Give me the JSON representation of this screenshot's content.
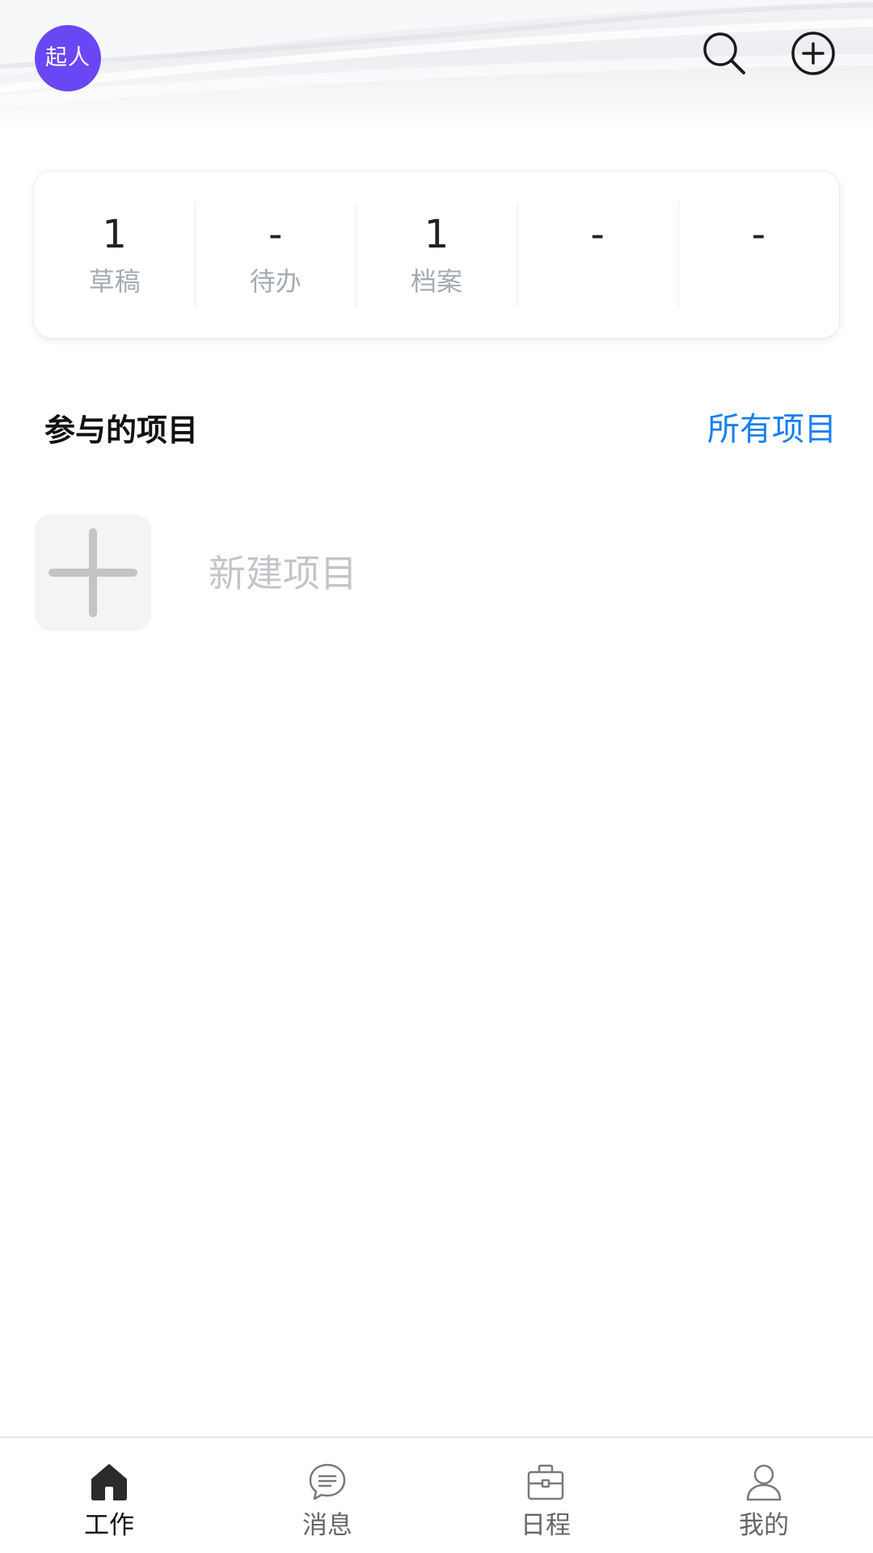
{
  "header": {
    "avatar_text": "起人",
    "avatar_color": "#6a47f5",
    "icons": [
      "search-icon",
      "add-circle-icon"
    ]
  },
  "stats": [
    {
      "value": "1",
      "label": "草稿"
    },
    {
      "value": "-",
      "label": "待办"
    },
    {
      "value": "1",
      "label": "档案"
    },
    {
      "value": "-",
      "label": ""
    },
    {
      "value": "-",
      "label": ""
    }
  ],
  "projects": {
    "title": "参与的项目",
    "all_link": "所有项目",
    "new_label": "新建项目",
    "link_color": "#1a7ff0"
  },
  "tabbar": {
    "active": "work",
    "tabs": [
      {
        "id": "work",
        "label": "工作",
        "icon": "home-icon"
      },
      {
        "id": "messages",
        "label": "消息",
        "icon": "chat-bubble-icon"
      },
      {
        "id": "schedule",
        "label": "日程",
        "icon": "briefcase-icon"
      },
      {
        "id": "mine",
        "label": "我的",
        "icon": "user-icon"
      }
    ]
  }
}
